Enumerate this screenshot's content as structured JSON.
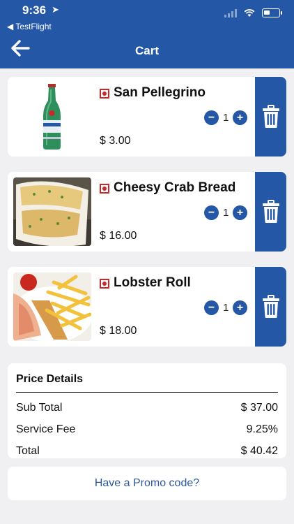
{
  "status_bar": {
    "time": "9:36",
    "back_app": "◀ TestFlight"
  },
  "header": {
    "title": "Cart",
    "back_icon": "arrow-left-icon"
  },
  "items": [
    {
      "name": "San Pellegrino",
      "qty": "1",
      "price": "$ 3.00"
    },
    {
      "name": "Cheesy Crab Bread",
      "qty": "1",
      "price": "$ 16.00"
    },
    {
      "name": "Lobster Roll",
      "qty": "1",
      "price": "$ 18.00"
    }
  ],
  "qty_controls": {
    "minus": "−",
    "plus": "+"
  },
  "price_details": {
    "title": "Price Details",
    "rows": [
      {
        "label": "Sub Total",
        "value": "$ 37.00"
      },
      {
        "label": "Service Fee",
        "value": "9.25%"
      },
      {
        "label": "Total",
        "value": "$ 40.42"
      }
    ]
  },
  "promo": {
    "label": "Have a Promo code?"
  },
  "colors": {
    "primary": "#2457a6",
    "background": "#f0f0f2",
    "veg_mark": "#c82828",
    "promo_text": "#2d5a9c"
  }
}
